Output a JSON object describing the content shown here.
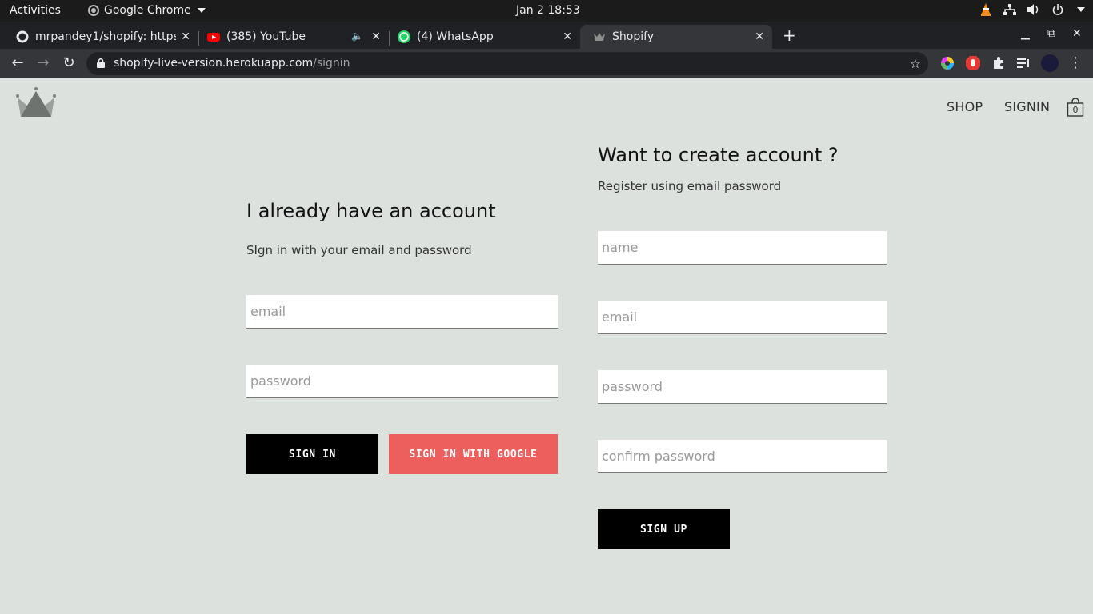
{
  "os_bar": {
    "activities": "Activities",
    "app_name": "Google Chrome",
    "clock": "Jan 2  18:53"
  },
  "tabs": [
    {
      "label": "mrpandey1/shopify: https",
      "icon": "github-icon"
    },
    {
      "label": "(385) YouTube",
      "icon": "youtube-icon",
      "muted": true
    },
    {
      "label": "(4) WhatsApp",
      "icon": "whatsapp-icon"
    },
    {
      "label": "Shopify",
      "icon": "crown-icon",
      "active": true
    }
  ],
  "omnibox": {
    "host": "shopify-live-version.herokuapp.com",
    "path": "/signin"
  },
  "header": {
    "nav": [
      "SHOP",
      "SIGNIN"
    ],
    "cart_count": "0"
  },
  "signin": {
    "title": "I already have an account",
    "subtitle": "SIgn in with your email and password",
    "email_placeholder": "email",
    "password_placeholder": "password",
    "signin_button": "SIGN IN",
    "google_button": "SIGN IN WITH GOOGLE"
  },
  "signup": {
    "title": "Want to create account ?",
    "subtitle": "Register using email password",
    "name_placeholder": "name",
    "email_placeholder": "email",
    "password_placeholder": "password",
    "confirm_placeholder": "confirm password",
    "signup_button": "SIGN UP"
  },
  "colors": {
    "page_bg": "#dce1de",
    "google_button": "#ec5f5d",
    "primary_button": "#000000"
  }
}
